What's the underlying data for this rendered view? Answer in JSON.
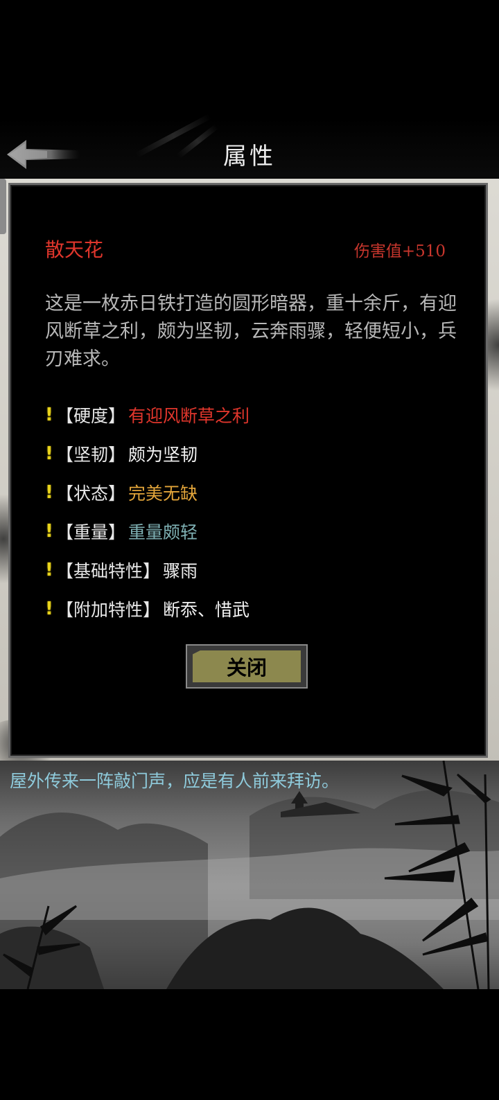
{
  "header": {
    "title": "属性",
    "back_icon": "back-arrow-icon"
  },
  "item": {
    "name": "散天花",
    "damage": "伤害值+510",
    "description": "这是一枚赤日铁打造的圆形暗器，重十余斤，有迎风断草之利，颇为坚韧，云奔雨骤，轻便短小，兵刃难求。"
  },
  "attributes": [
    {
      "mark": "!",
      "label": "【硬度】",
      "value": "有迎风断草之利",
      "color": "#e0362c"
    },
    {
      "mark": "!",
      "label": "【坚韧】",
      "value": "颇为坚韧",
      "color": "#f2f2f2"
    },
    {
      "mark": "!",
      "label": "【状态】",
      "value": "完美无缺",
      "color": "#e3a53a"
    },
    {
      "mark": "!",
      "label": "【重量】",
      "value": "重量颇轻",
      "color": "#7fb1b4"
    },
    {
      "mark": "!",
      "label": "【基础特性】",
      "value": "骤雨",
      "color": "#f2f2f2"
    },
    {
      "mark": "!",
      "label": "【附加特性】",
      "value": "断忝、惜武",
      "color": "#f2f2f2"
    }
  ],
  "dialog": {
    "close_label": "关闭"
  },
  "scene": {
    "message": "屋外传来一阵敲门声，应是有人前来拜访。"
  },
  "colors": {
    "item_name": "#e0362c",
    "damage": "#c8362d",
    "description": "#b8b8b8",
    "exclaim": "#e7d21b",
    "button": "#8c884e",
    "message": "#8fcbdc"
  }
}
